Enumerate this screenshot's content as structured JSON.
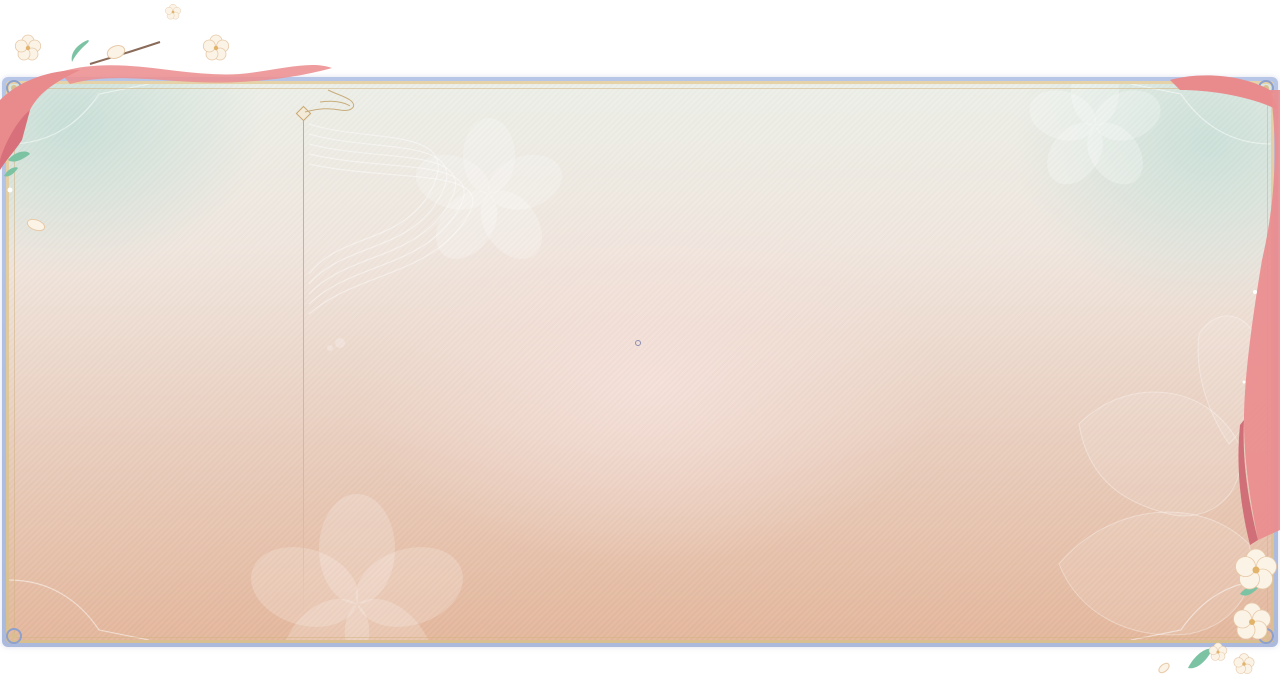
{
  "screen": {
    "type": "decorative-empty-dialog",
    "theme": "cherry-blossom",
    "colors": {
      "frame_outer": "#aab9dc",
      "frame_gold": "#d9bf8f",
      "panel_top": "#ecefe8",
      "panel_bottom": "#e4b79c",
      "ribbon": "#e98a8c",
      "blossom": "#fbf3e6",
      "leaf": "#7cc3a4"
    }
  },
  "left_panel": {},
  "right_panel": {}
}
